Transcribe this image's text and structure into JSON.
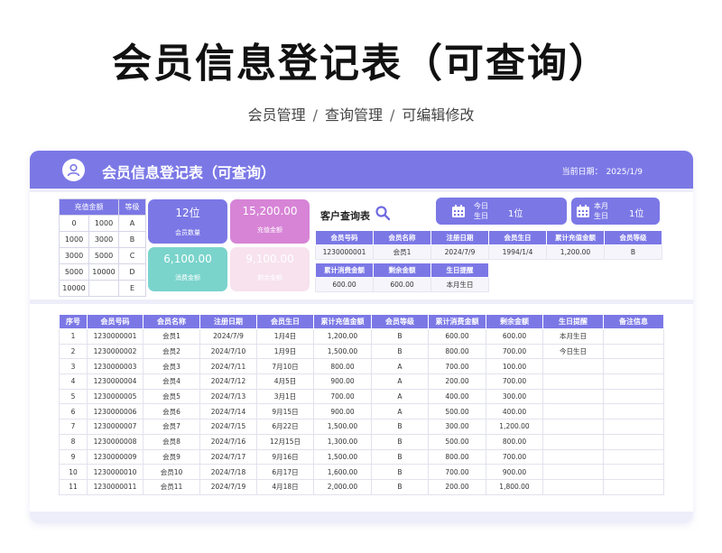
{
  "page": {
    "title": "会员信息登记表（可查询）",
    "breadcrumb": [
      "会员管理",
      "查询管理",
      "可编辑修改"
    ],
    "breadcrumb_sep": "/"
  },
  "header": {
    "title": "会员信息登记表（可查询）",
    "date_label": "当前日期：",
    "date_value": "2025/1/9"
  },
  "level_table": {
    "headers": [
      "充值金额",
      "",
      "等级"
    ],
    "rows": [
      [
        "0",
        "1000",
        "A"
      ],
      [
        "1000",
        "3000",
        "B"
      ],
      [
        "3000",
        "5000",
        "C"
      ],
      [
        "5000",
        "10000",
        "D"
      ],
      [
        "10000",
        "",
        "E"
      ]
    ]
  },
  "cards": [
    {
      "value": "12位",
      "label": "会员数量"
    },
    {
      "value": "15,200.00",
      "label": "充值金额"
    },
    {
      "value": "6,100.00",
      "label": "消费金额"
    },
    {
      "value": "9,100.00",
      "label": "剩余金额"
    }
  ],
  "query": {
    "label": "客户查询表",
    "today_birthday_label": [
      "今日",
      "生日"
    ],
    "today_birthday_count": "1位",
    "month_birthday_label": [
      "本月",
      "生日"
    ],
    "month_birthday_count": "1位"
  },
  "query_table": {
    "headers1": [
      "会员号码",
      "会员名称",
      "注册日期",
      "会员生日",
      "累计充值金额",
      "会员等级"
    ],
    "row1": [
      "1230000001",
      "会员1",
      "2024/7/9",
      "1994/1/4",
      "1,200.00",
      "B"
    ],
    "headers2": [
      "累计消费金额",
      "剩余金额",
      "生日提醒"
    ],
    "row2": [
      "600.00",
      "600.00",
      "本月生日"
    ]
  },
  "main_table": {
    "headers": [
      "序号",
      "会员号码",
      "会员名称",
      "注册日期",
      "会员生日",
      "累计充值金额",
      "会员等级",
      "累计消费金额",
      "剩余金额",
      "生日提醒",
      "备注信息"
    ],
    "rows": [
      [
        "1",
        "1230000001",
        "会员1",
        "2024/7/9",
        "1月4日",
        "1,200.00",
        "B",
        "600.00",
        "600.00",
        "本月生日",
        ""
      ],
      [
        "2",
        "1230000002",
        "会员2",
        "2024/7/10",
        "1月9日",
        "1,500.00",
        "B",
        "800.00",
        "700.00",
        "今日生日",
        ""
      ],
      [
        "3",
        "1230000003",
        "会员3",
        "2024/7/11",
        "7月10日",
        "800.00",
        "A",
        "700.00",
        "100.00",
        "",
        ""
      ],
      [
        "4",
        "1230000004",
        "会员4",
        "2024/7/12",
        "4月5日",
        "900.00",
        "A",
        "200.00",
        "700.00",
        "",
        ""
      ],
      [
        "5",
        "1230000005",
        "会员5",
        "2024/7/13",
        "3月1日",
        "700.00",
        "A",
        "400.00",
        "300.00",
        "",
        ""
      ],
      [
        "6",
        "1230000006",
        "会员6",
        "2024/7/14",
        "9月15日",
        "900.00",
        "A",
        "500.00",
        "400.00",
        "",
        ""
      ],
      [
        "7",
        "1230000007",
        "会员7",
        "2024/7/15",
        "6月22日",
        "1,500.00",
        "B",
        "300.00",
        "1,200.00",
        "",
        ""
      ],
      [
        "8",
        "1230000008",
        "会员8",
        "2024/7/16",
        "12月15日",
        "1,300.00",
        "B",
        "500.00",
        "800.00",
        "",
        ""
      ],
      [
        "9",
        "1230000009",
        "会员9",
        "2024/7/17",
        "9月16日",
        "1,500.00",
        "B",
        "800.00",
        "700.00",
        "",
        ""
      ],
      [
        "10",
        "1230000010",
        "会员10",
        "2024/7/18",
        "6月17日",
        "1,600.00",
        "B",
        "700.00",
        "900.00",
        "",
        ""
      ],
      [
        "11",
        "1230000011",
        "会员11",
        "2024/7/19",
        "4月18日",
        "2,000.00",
        "B",
        "200.00",
        "1,800.00",
        "",
        ""
      ]
    ]
  },
  "colors": {
    "accent": "#7b78e6",
    "pink": "#d784d6",
    "teal": "#7ad4cc",
    "light_pink": "#f7e2ee"
  }
}
